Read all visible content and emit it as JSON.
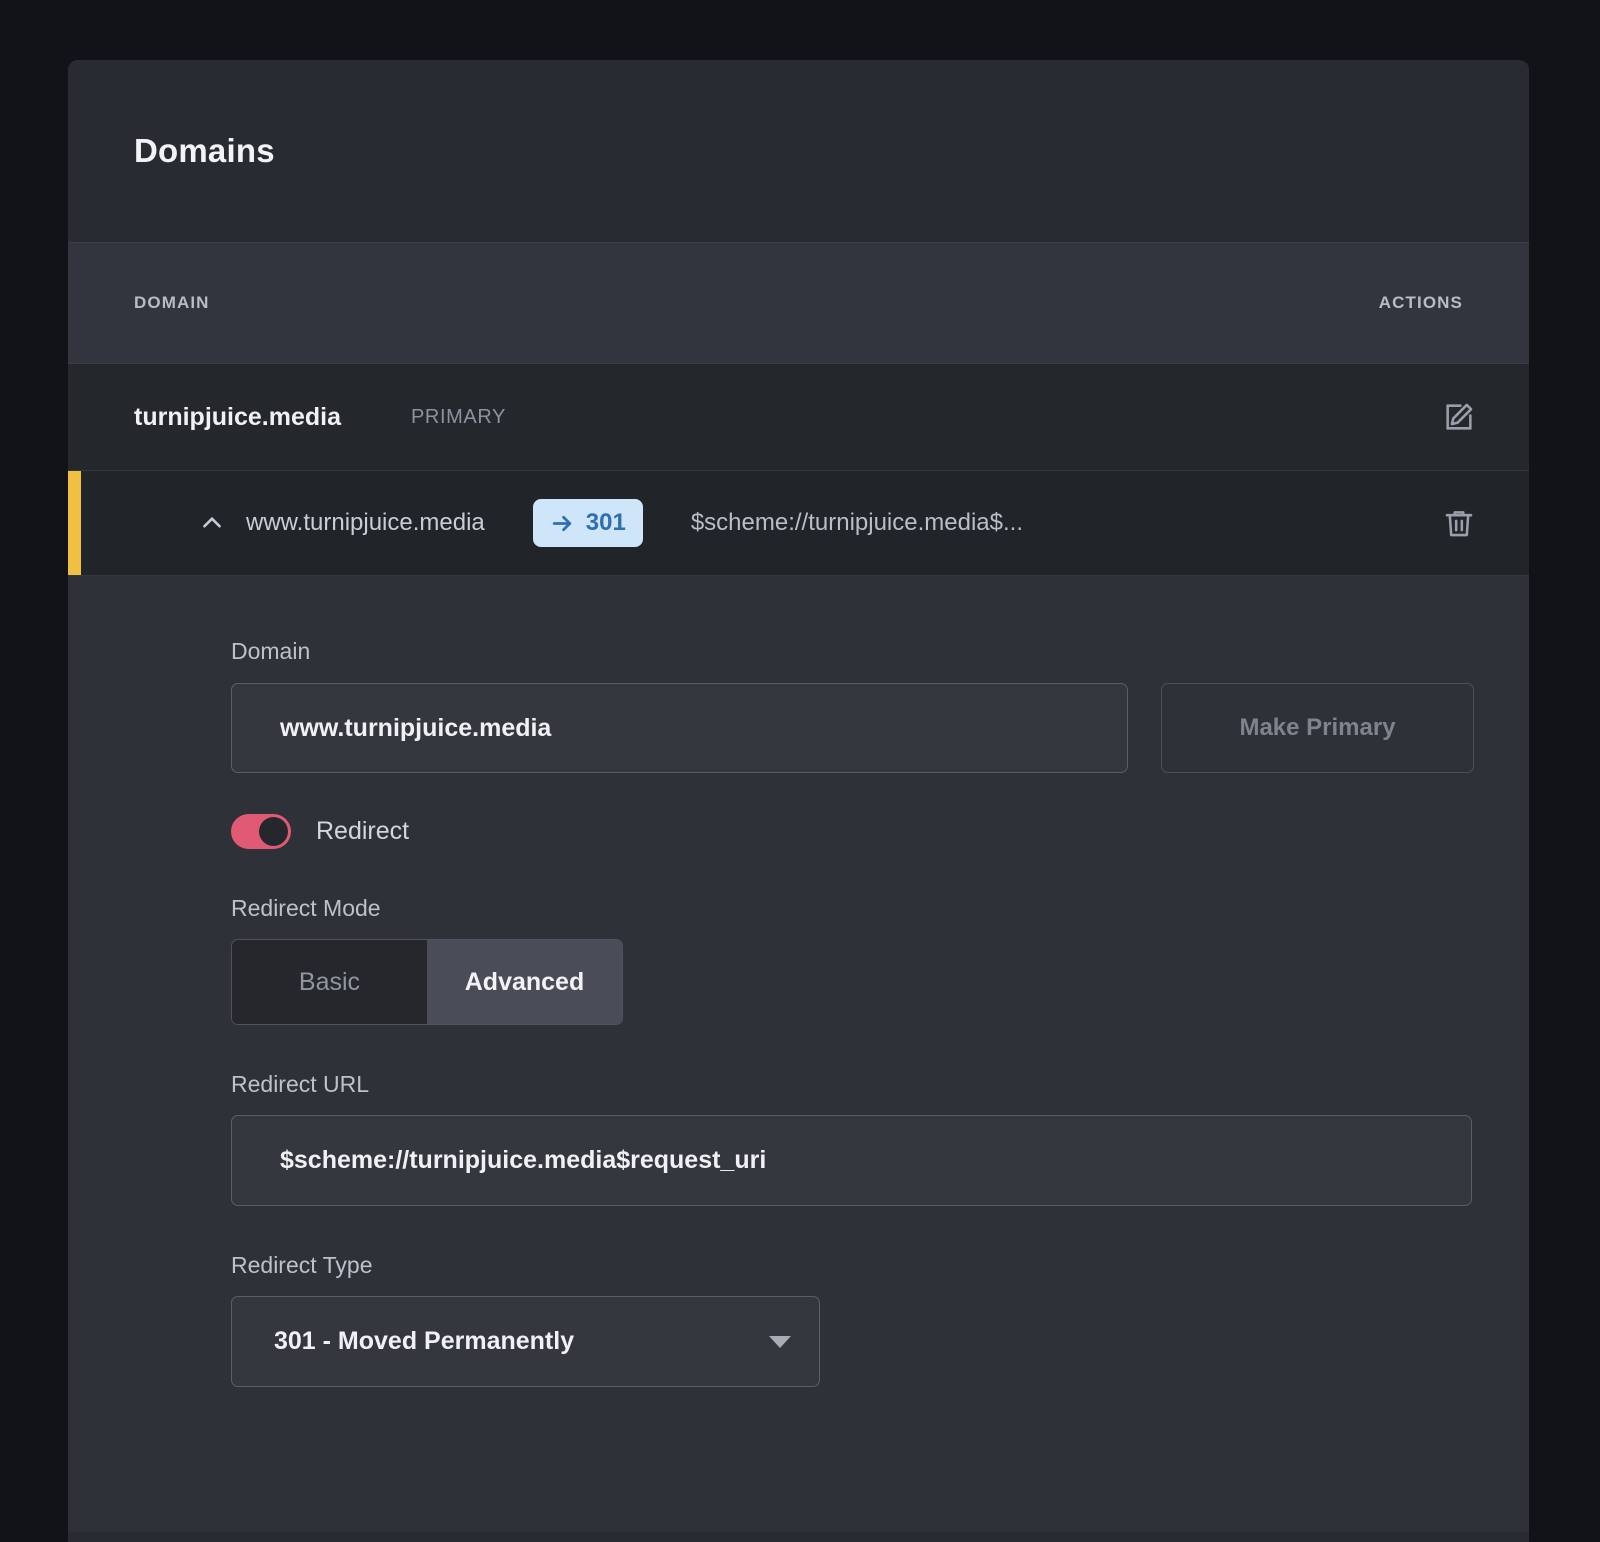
{
  "card": {
    "title": "Domains"
  },
  "table": {
    "headers": {
      "domain": "DOMAIN",
      "actions": "ACTIONS"
    },
    "rows": [
      {
        "name": "turnipjuice.media",
        "tag": "PRIMARY",
        "action_icon": "edit-icon"
      }
    ],
    "redirect_row": {
      "collapse_icon": "chevron-up-icon",
      "domain": "www.turnipjuice.media",
      "badge_arrow_icon": "arrow-right-icon",
      "badge_code": "301",
      "target": "$scheme://turnipjuice.media$...",
      "action_icon": "trash-icon",
      "accent_color": "#f1c043"
    }
  },
  "detail": {
    "domain_label": "Domain",
    "domain_value": "www.turnipjuice.media",
    "make_primary_label": "Make Primary",
    "redirect_toggle_label": "Redirect",
    "redirect_toggle_on": true,
    "redirect_toggle_color": "#e05a75",
    "redirect_mode_label": "Redirect Mode",
    "mode_basic": "Basic",
    "mode_advanced": "Advanced",
    "mode_selected": "Advanced",
    "redirect_url_label": "Redirect URL",
    "redirect_url_value": "$scheme://turnipjuice.media$request_uri",
    "redirect_type_label": "Redirect Type",
    "redirect_type_value": "301 - Moved Permanently",
    "dropdown_icon": "chevron-down-icon"
  }
}
